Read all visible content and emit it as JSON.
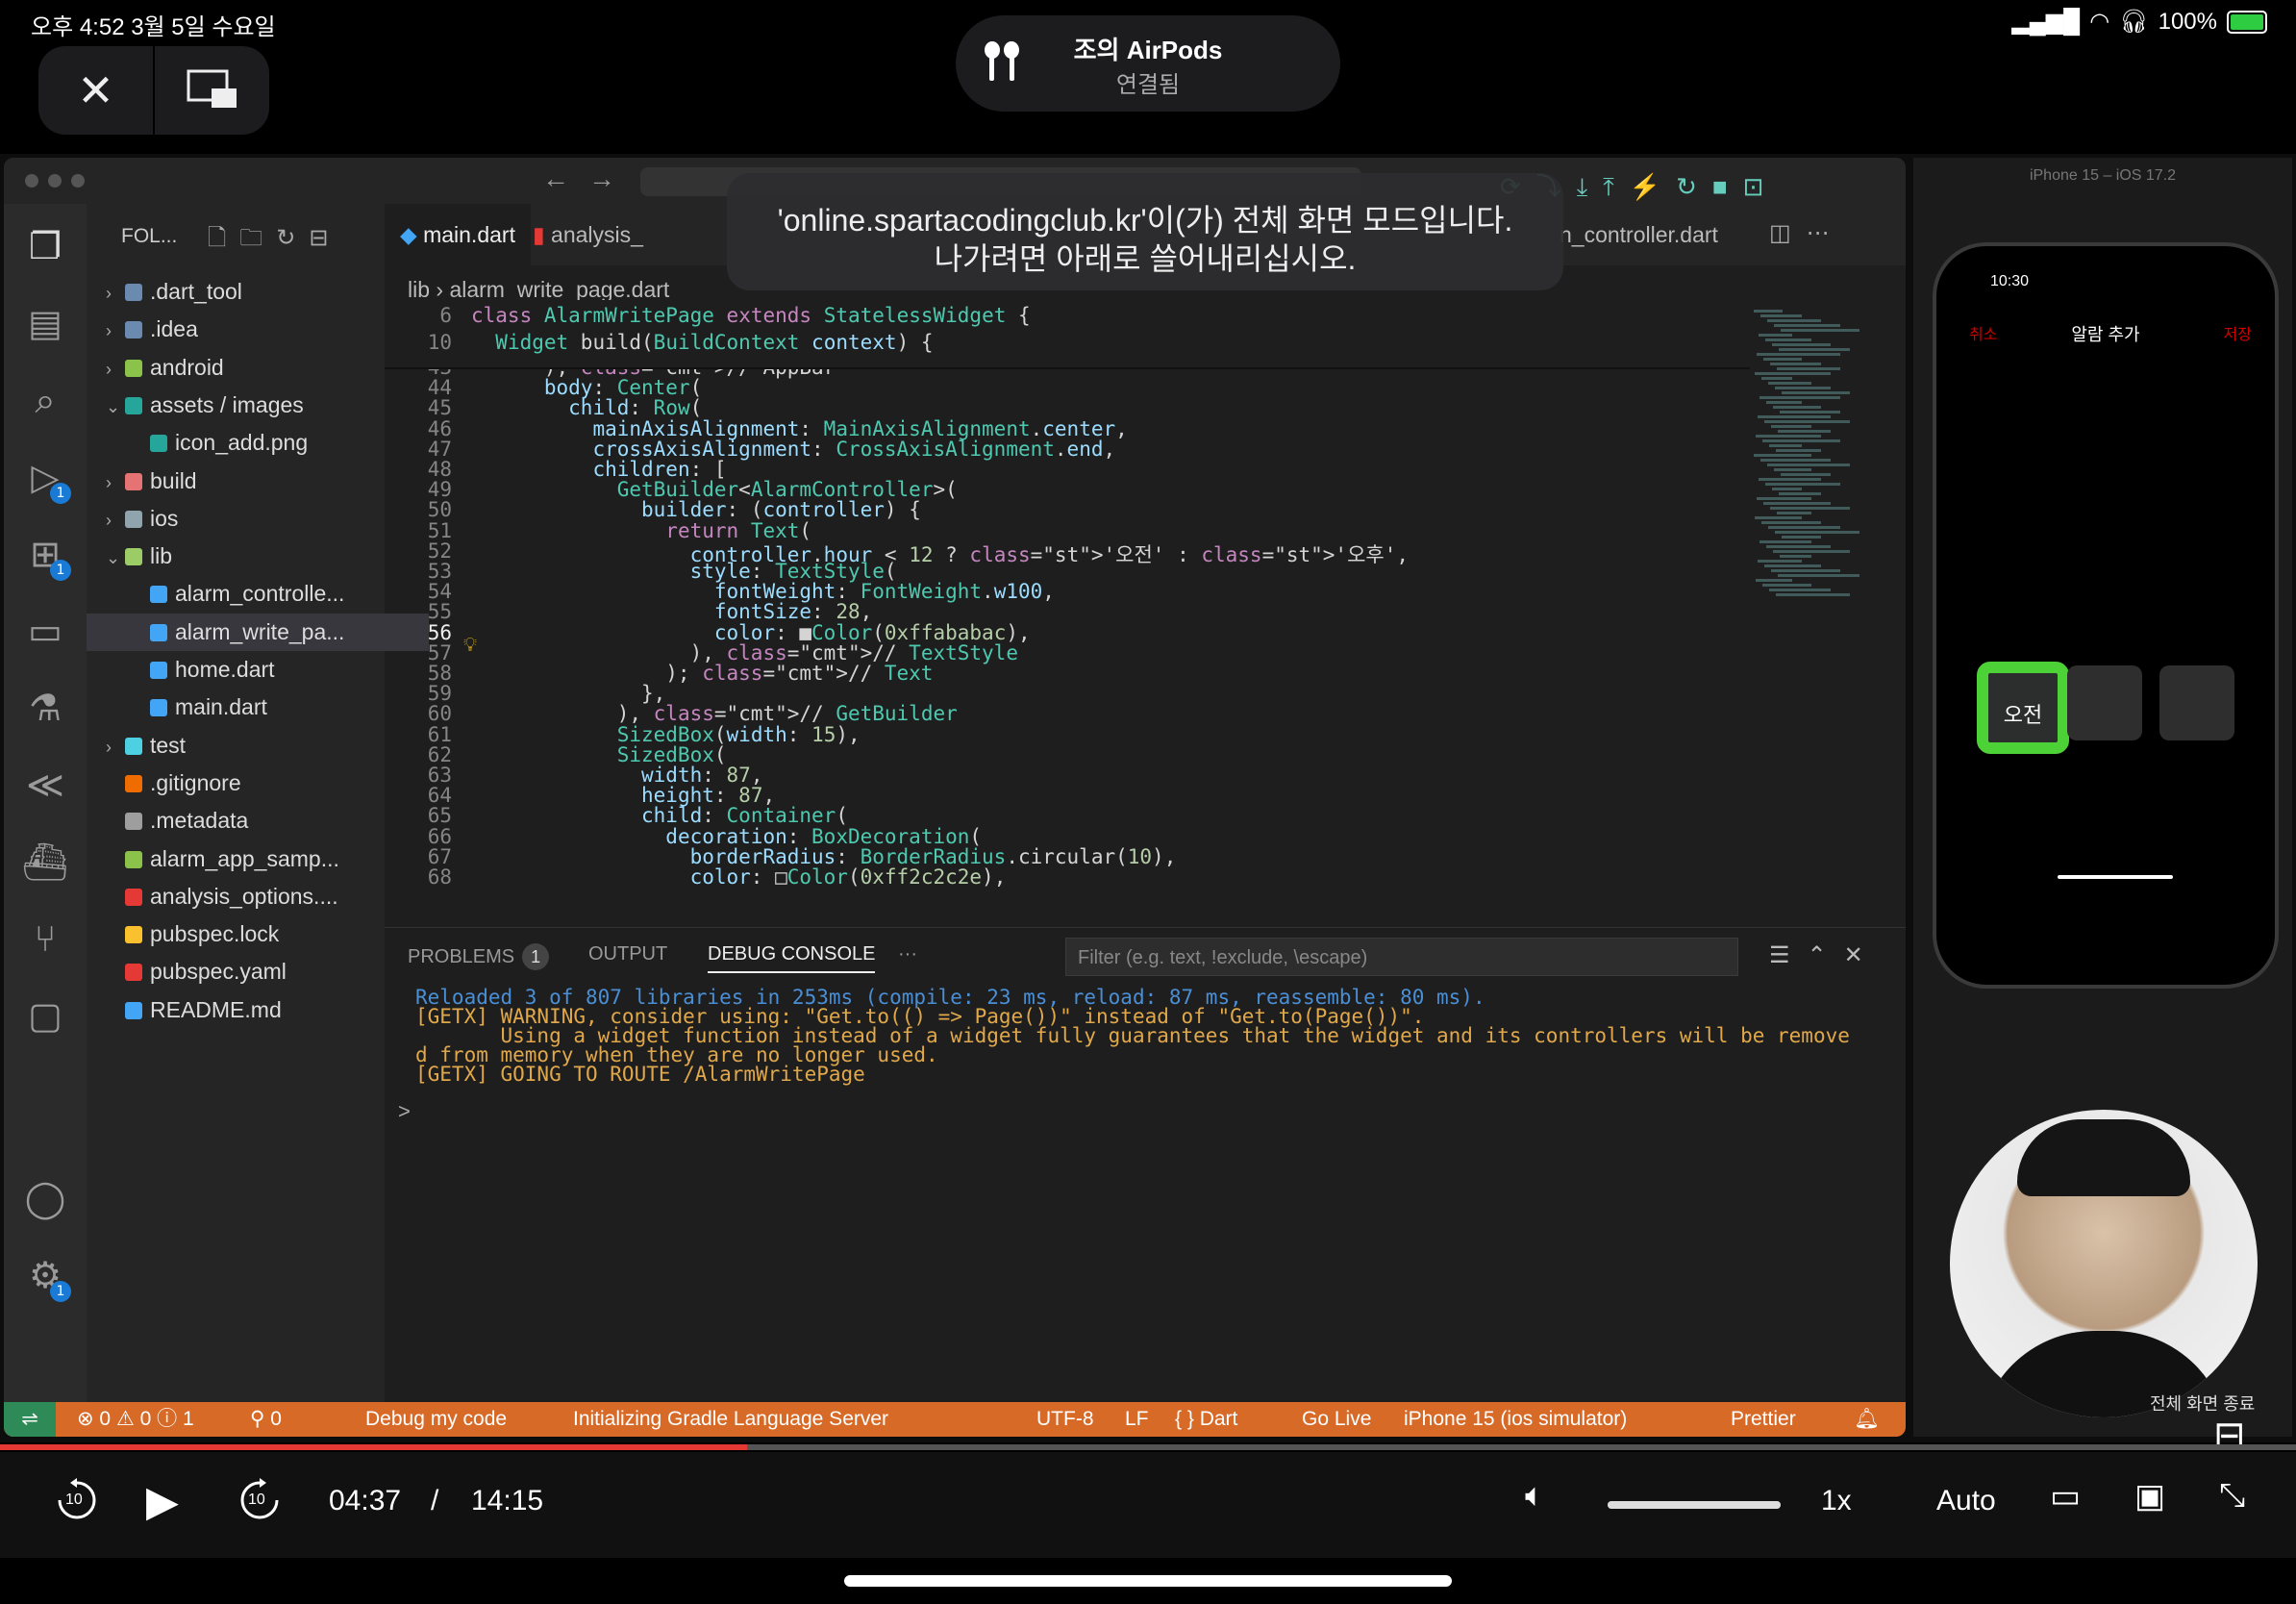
{
  "ios_status": {
    "time_date": "오후 4:52   3월 5일 수요일",
    "battery": "100%"
  },
  "overlay": {
    "close_icon": "close-icon",
    "pip_icon": "picture-in-picture-icon"
  },
  "airpods": {
    "title": "조의 AirPods",
    "subtitle": "연결됨"
  },
  "toast": {
    "line1": "'online.spartacodingclub.kr'이(가) 전체 화면 모드입니다.",
    "line2": "나가려면 아래로 쓸어내리십시오."
  },
  "explorer": {
    "header": "FOL...",
    "items": [
      {
        "label": ".dart_tool",
        "type": "folder",
        "chevron": "›",
        "indent": 0,
        "color": "#6b8ab0"
      },
      {
        "label": ".idea",
        "type": "folder",
        "chevron": "›",
        "indent": 0,
        "color": "#6b8ab0"
      },
      {
        "label": "android",
        "type": "folder",
        "chevron": "›",
        "indent": 0,
        "color": "#8bc34a"
      },
      {
        "label": "assets / images",
        "type": "folder",
        "chevron": "⌄",
        "indent": 0,
        "color": "#26a69a"
      },
      {
        "label": "icon_add.png",
        "type": "file",
        "chevron": "",
        "indent": 1,
        "color": "#26a69a"
      },
      {
        "label": "build",
        "type": "folder",
        "chevron": "›",
        "indent": 0,
        "color": "#e57373"
      },
      {
        "label": "ios",
        "type": "folder",
        "chevron": "›",
        "indent": 0,
        "color": "#90a4ae"
      },
      {
        "label": "lib",
        "type": "folder",
        "chevron": "⌄",
        "indent": 0,
        "color": "#9ccc65"
      },
      {
        "label": "alarm_controlle...",
        "type": "file",
        "chevron": "",
        "indent": 1,
        "color": "#42a5f5"
      },
      {
        "label": "alarm_write_pa...",
        "type": "file",
        "chevron": "",
        "indent": 1,
        "color": "#42a5f5",
        "selected": true
      },
      {
        "label": "home.dart",
        "type": "file",
        "chevron": "",
        "indent": 1,
        "color": "#42a5f5"
      },
      {
        "label": "main.dart",
        "type": "file",
        "chevron": "",
        "indent": 1,
        "color": "#42a5f5"
      },
      {
        "label": "test",
        "type": "folder",
        "chevron": "›",
        "indent": 0,
        "color": "#4dd0e1"
      },
      {
        "label": ".gitignore",
        "type": "file",
        "chevron": "",
        "indent": 0,
        "color": "#ef6c00"
      },
      {
        "label": ".metadata",
        "type": "file",
        "chevron": "",
        "indent": 0,
        "color": "#9e9e9e"
      },
      {
        "label": "alarm_app_samp...",
        "type": "file",
        "chevron": "",
        "indent": 0,
        "color": "#8bc34a"
      },
      {
        "label": "analysis_options....",
        "type": "file",
        "chevron": "",
        "indent": 0,
        "color": "#e53935"
      },
      {
        "label": "pubspec.lock",
        "type": "file",
        "chevron": "",
        "indent": 0,
        "color": "#fbc02d"
      },
      {
        "label": "pubspec.yaml",
        "type": "file",
        "chevron": "",
        "indent": 0,
        "color": "#e53935"
      },
      {
        "label": "README.md",
        "type": "file",
        "chevron": "",
        "indent": 0,
        "color": "#42a5f5"
      }
    ]
  },
  "tabs": [
    "main.dart",
    "analysis_",
    "n_controller.dart"
  ],
  "breadcrumb": "lib  ›  alarm_write_page.dart",
  "editor": {
    "sticky": [
      {
        "n": "6",
        "text": "class AlarmWritePage extends StatelessWidget {"
      },
      {
        "n": "10",
        "text": "  Widget build(BuildContext context) {"
      }
    ],
    "lines": [
      {
        "n": "43",
        "text": "      ), // AppBar"
      },
      {
        "n": "44",
        "text": "      body: Center("
      },
      {
        "n": "45",
        "text": "        child: Row("
      },
      {
        "n": "46",
        "text": "          mainAxisAlignment: MainAxisAlignment.center,"
      },
      {
        "n": "47",
        "text": "          crossAxisAlignment: CrossAxisAlignment.end,"
      },
      {
        "n": "48",
        "text": "          children: ["
      },
      {
        "n": "49",
        "text": "            GetBuilder<AlarmController>("
      },
      {
        "n": "50",
        "text": "              builder: (controller) {"
      },
      {
        "n": "51",
        "text": "                return Text("
      },
      {
        "n": "52",
        "text": "                  controller.hour < 12 ? '오전' : '오후',"
      },
      {
        "n": "53",
        "text": "                  style: TextStyle("
      },
      {
        "n": "54",
        "text": "                    fontWeight: FontWeight.w100,"
      },
      {
        "n": "55",
        "text": "                    fontSize: 28,"
      },
      {
        "n": "56",
        "text": "                    color: ■Color(0xffababac),"
      },
      {
        "n": "57",
        "text": "                  ), // TextStyle"
      },
      {
        "n": "58",
        "text": "                ); // Text"
      },
      {
        "n": "59",
        "text": "              },"
      },
      {
        "n": "60",
        "text": "            ), // GetBuilder"
      },
      {
        "n": "61",
        "text": "            SizedBox(width: 15),"
      },
      {
        "n": "62",
        "text": "            SizedBox("
      },
      {
        "n": "63",
        "text": "              width: 87,"
      },
      {
        "n": "64",
        "text": "              height: 87,"
      },
      {
        "n": "65",
        "text": "              child: Container("
      },
      {
        "n": "66",
        "text": "                decoration: BoxDecoration("
      },
      {
        "n": "67",
        "text": "                  borderRadius: BorderRadius.circular(10),"
      },
      {
        "n": "68",
        "text": "                  color: □Color(0xff2c2c2e),"
      }
    ]
  },
  "panel": {
    "tabs": [
      "PROBLEMS",
      "OUTPUT",
      "DEBUG CONSOLE",
      "···"
    ],
    "problems_count": "1",
    "filter_placeholder": "Filter (e.g. text, !exclude, \\escape)",
    "log": [
      "Reloaded 3 of 807 libraries in 253ms (compile: 23 ms, reload: 87 ms, reassemble: 80 ms).",
      "[GETX] WARNING, consider using: \"Get.to(() => Page())\" instead of \"Get.to(Page())\".",
      "       Using a widget function instead of a widget fully guarantees that the widget and its controllers will be remove",
      "d from memory when they are no longer used.",
      "[GETX] GOING TO ROUTE /AlarmWritePage"
    ],
    "prompt": ">"
  },
  "vs_status": {
    "problems": "⊗ 0 ⚠ 0 ⓘ 1",
    "ports": "⚲ 0",
    "debug": "Debug my code",
    "task": "Initializing Gradle Language Server",
    "encoding": "UTF-8",
    "eol": "LF",
    "language": "{ } Dart",
    "golive": "Go Live",
    "device": "iPhone 15 (ios simulator)",
    "prettier": "Prettier"
  },
  "simulator": {
    "title": "iPhone 15 – iOS 17.2",
    "phone_time": "10:30",
    "cancel": "취소",
    "screen_title": "알람 추가",
    "save": "저장",
    "ampm": "오전"
  },
  "fullscreen_label": "전체 화면 종료",
  "player": {
    "current": "04:37",
    "separator": "/",
    "duration": "14:15",
    "speed": "1x",
    "quality": "Auto",
    "progress_fraction": 0.3254,
    "volume_fraction": 1.0,
    "skip_seconds": "10"
  }
}
